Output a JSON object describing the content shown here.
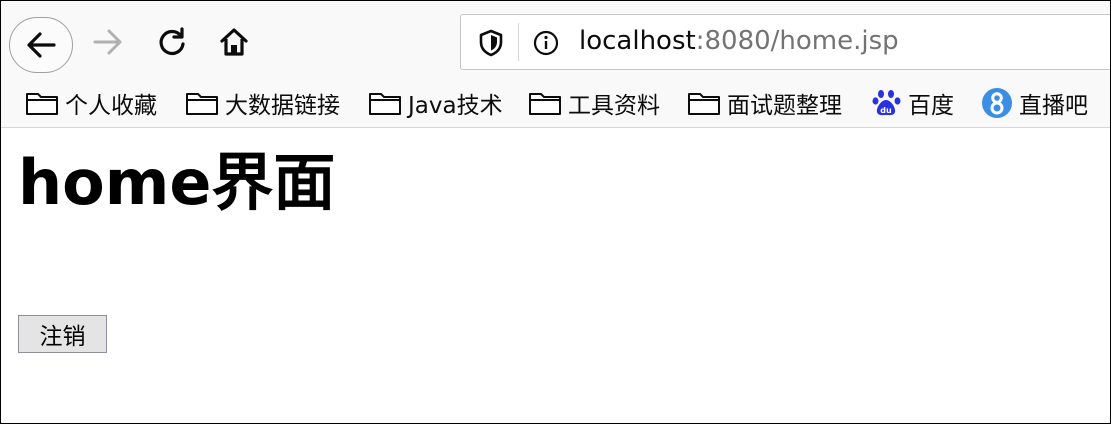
{
  "toolbar": {
    "back_icon": "arrow-left-icon",
    "forward_icon": "arrow-right-icon",
    "reload_icon": "reload-icon",
    "home_icon": "home-icon"
  },
  "urlbar": {
    "host": "localhost",
    "rest": ":8080/home.jsp"
  },
  "bookmarks": [
    {
      "label": "个人收藏",
      "icon": "folder-icon"
    },
    {
      "label": "大数据链接",
      "icon": "folder-icon"
    },
    {
      "label": "Java技术",
      "icon": "folder-icon"
    },
    {
      "label": "工具资料",
      "icon": "folder-icon"
    },
    {
      "label": "面试题整理",
      "icon": "folder-icon"
    },
    {
      "label": "百度",
      "icon": "baidu-paw-icon"
    },
    {
      "label": "直播吧",
      "icon": "zhibo8-icon"
    }
  ],
  "page": {
    "title": "home界面",
    "logout_label": "注销"
  },
  "colors": {
    "chrome_bg": "#f9f9fa",
    "baidu_blue": "#2932e1",
    "zhibo_blue": "#3a8ee6"
  }
}
